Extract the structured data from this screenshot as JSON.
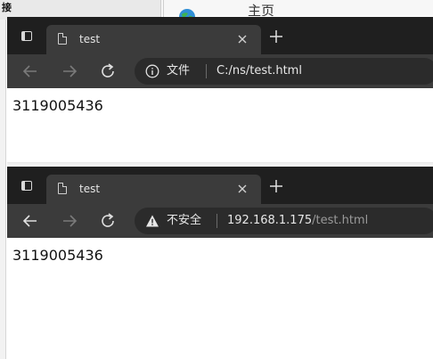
{
  "background": {
    "left_title": "接",
    "right_title": "主页"
  },
  "windows": [
    {
      "tab_title": "test",
      "security_label": "文件",
      "url_main": "C:/ns/test.html",
      "url_dim": "",
      "page_text": "3119005436",
      "security_icon": "info-icon"
    },
    {
      "tab_title": "test",
      "security_label": "不安全",
      "url_main": "192.168.1.175",
      "url_dim": "/test.html",
      "page_text": "3119005436",
      "security_icon": "warning-icon"
    }
  ],
  "colors": {
    "tabbar": "#1f1f1f",
    "toolbar": "#3b3b3b",
    "address_bar": "#2b2b2b",
    "text_light": "#e8e8e8",
    "text_dim": "#9a9a9a"
  }
}
